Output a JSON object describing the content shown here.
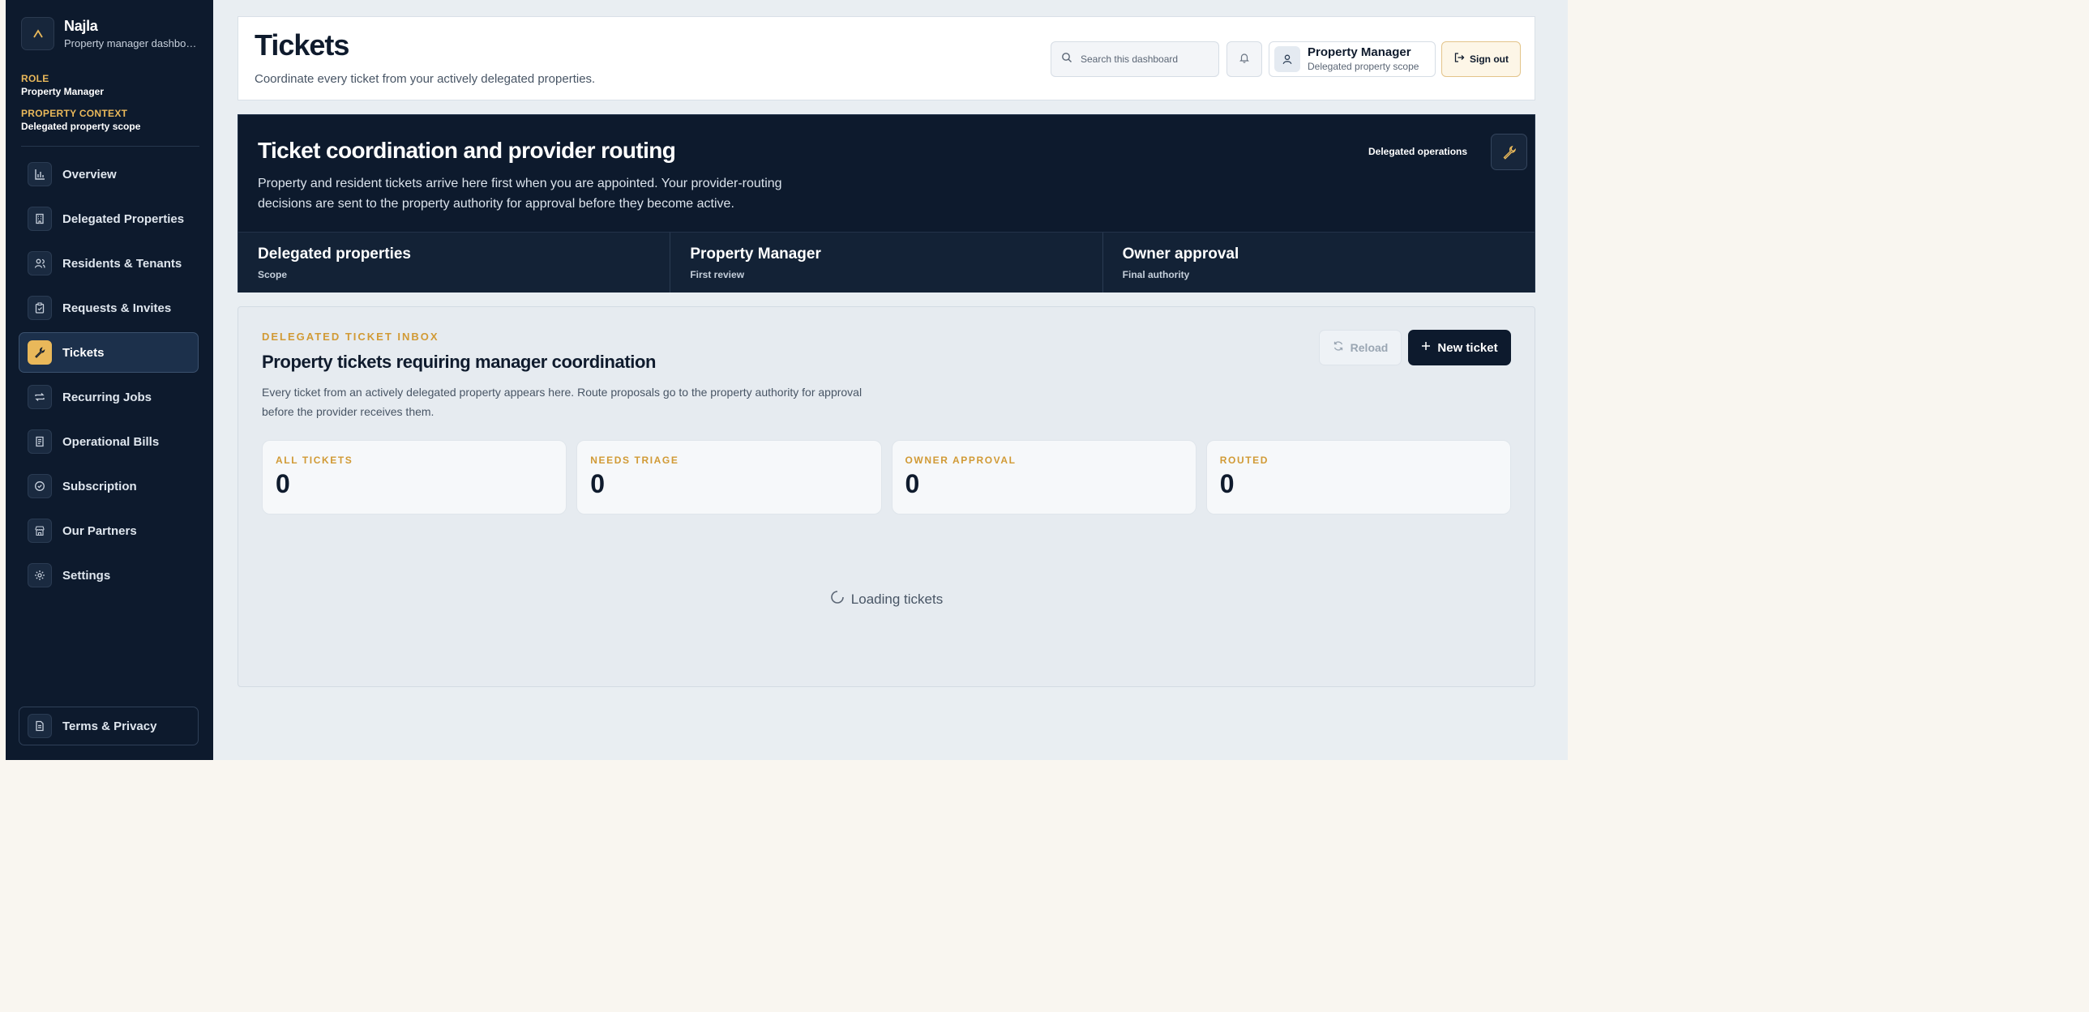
{
  "brand": {
    "name": "Najla",
    "subtitle": "Property manager dashboard"
  },
  "meta": {
    "role_label": "ROLE",
    "role_value": "Property Manager",
    "context_label": "PROPERTY CONTEXT",
    "context_value": "Delegated property scope"
  },
  "nav": [
    {
      "label": "Overview",
      "icon": "bar-chart-icon"
    },
    {
      "label": "Delegated Properties",
      "icon": "building-icon"
    },
    {
      "label": "Residents & Tenants",
      "icon": "users-icon"
    },
    {
      "label": "Requests & Invites",
      "icon": "clipboard-icon"
    },
    {
      "label": "Tickets",
      "icon": "wrench-icon",
      "active": true
    },
    {
      "label": "Recurring Jobs",
      "icon": "repeat-icon"
    },
    {
      "label": "Operational Bills",
      "icon": "receipt-icon"
    },
    {
      "label": "Subscription",
      "icon": "badge-check-icon"
    },
    {
      "label": "Our Partners",
      "icon": "store-icon"
    },
    {
      "label": "Settings",
      "icon": "gear-icon"
    }
  ],
  "terms": {
    "label": "Terms & Privacy",
    "icon": "document-icon"
  },
  "header": {
    "title": "Tickets",
    "subtitle": "Coordinate every ticket from your actively delegated properties.",
    "search_placeholder": "Search this dashboard",
    "user_name": "Property Manager",
    "user_scope": "Delegated property scope",
    "signout_label": "Sign out"
  },
  "hero": {
    "title": "Ticket coordination and provider routing",
    "description": "Property and resident tickets arrive here first when you are appointed. Your provider-routing decisions are sent to the property authority for approval before they become active.",
    "tag": "Delegated operations",
    "stats": [
      {
        "title": "Delegated properties",
        "sub": "Scope"
      },
      {
        "title": "Property Manager",
        "sub": "First review"
      },
      {
        "title": "Owner approval",
        "sub": "Final authority"
      }
    ]
  },
  "inbox": {
    "eyebrow": "DELEGATED TICKET INBOX",
    "title": "Property tickets requiring manager coordination",
    "description": "Every ticket from an actively delegated property appears here. Route proposals go to the property authority for approval before the provider receives them.",
    "reload_label": "Reload",
    "new_ticket_label": "New ticket",
    "metrics": [
      {
        "label": "ALL TICKETS",
        "value": "0"
      },
      {
        "label": "NEEDS TRIAGE",
        "value": "0"
      },
      {
        "label": "OWNER APPROVAL",
        "value": "0"
      },
      {
        "label": "ROUTED",
        "value": "0"
      }
    ],
    "loading_label": "Loading tickets"
  },
  "colors": {
    "navy": "#0d1a2d",
    "accent": "#e9b85a",
    "eyebrow": "#d19a35",
    "page_bg": "#f9f6f0"
  }
}
